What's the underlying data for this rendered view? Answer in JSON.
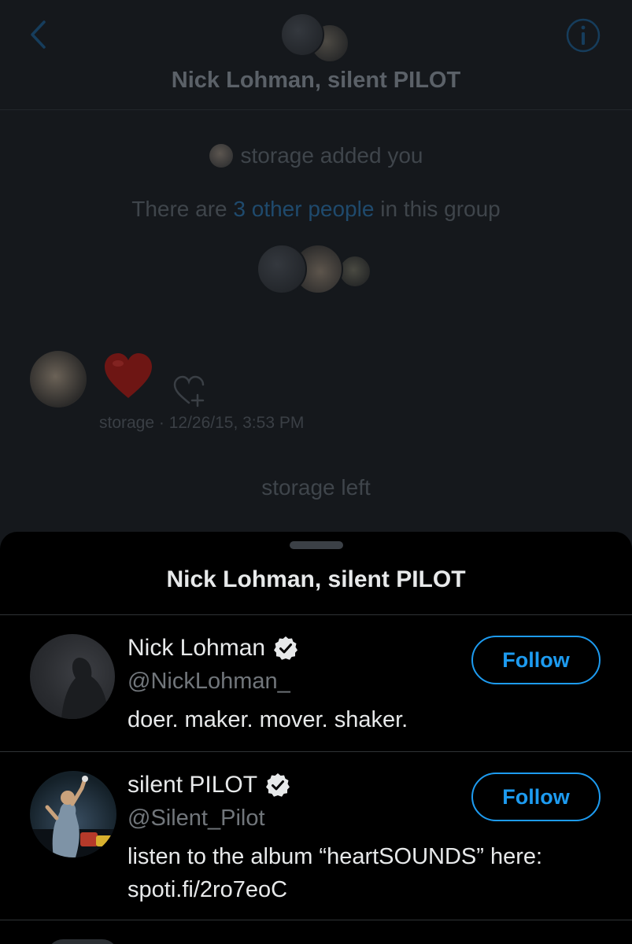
{
  "header": {
    "title": "Nick Lohman, silent PILOT",
    "back_icon": "chevron-left-icon",
    "info_icon": "info-icon"
  },
  "conversation": {
    "added_sender": "storage",
    "added_text": "storage added you",
    "people_prefix": "There are ",
    "people_link": "3 other people",
    "people_suffix": " in this group",
    "message": {
      "content": "heart",
      "sender": "storage",
      "timestamp": "· 12/26/15, 3:53 PM"
    },
    "left_text": "storage left"
  },
  "sheet": {
    "title": "Nick Lohman, silent PILOT",
    "users": [
      {
        "name": "Nick Lohman",
        "handle": "@NickLohman_",
        "bio": "doer. maker. mover. shaker.",
        "bio_link": "",
        "verified": true,
        "follow_label": "Follow"
      },
      {
        "name": "silent PILOT",
        "handle": "@Silent_Pilot",
        "bio": "listen to the album “heartSOUNDS” here:",
        "bio_link": "spoti.fi/2ro7eoC",
        "verified": true,
        "follow_label": "Follow"
      }
    ]
  },
  "colors": {
    "accent": "#1d9bf0",
    "background": "#000000",
    "dimmed_background": "#15181c",
    "secondary_text": "#71767b"
  }
}
